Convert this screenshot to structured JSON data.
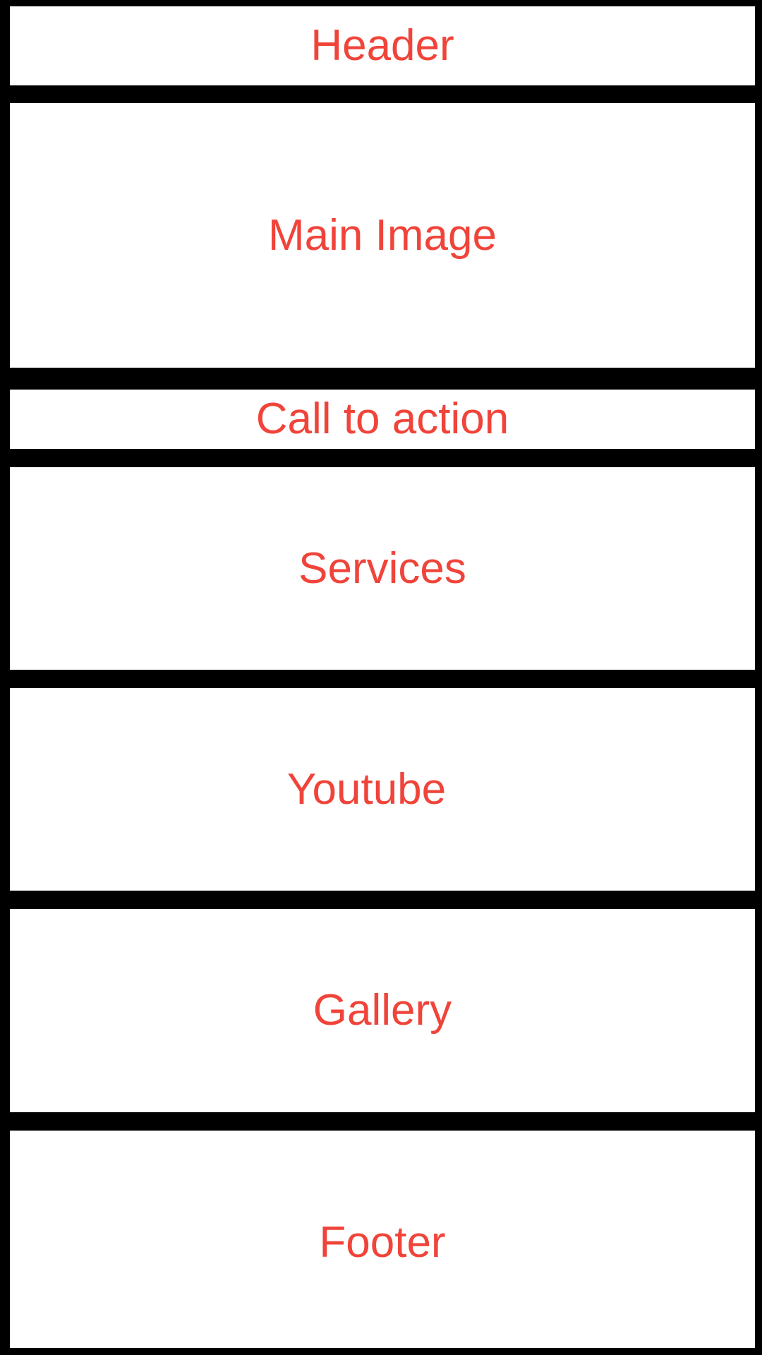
{
  "sections": {
    "header": "Header",
    "main_image": "Main Image",
    "call_to_action": "Call to action",
    "services": "Services",
    "youtube": "Youtube",
    "gallery": "Gallery",
    "footer": "Footer"
  },
  "colors": {
    "label": "#f0443a",
    "border": "#000000",
    "fill": "#ffffff"
  }
}
